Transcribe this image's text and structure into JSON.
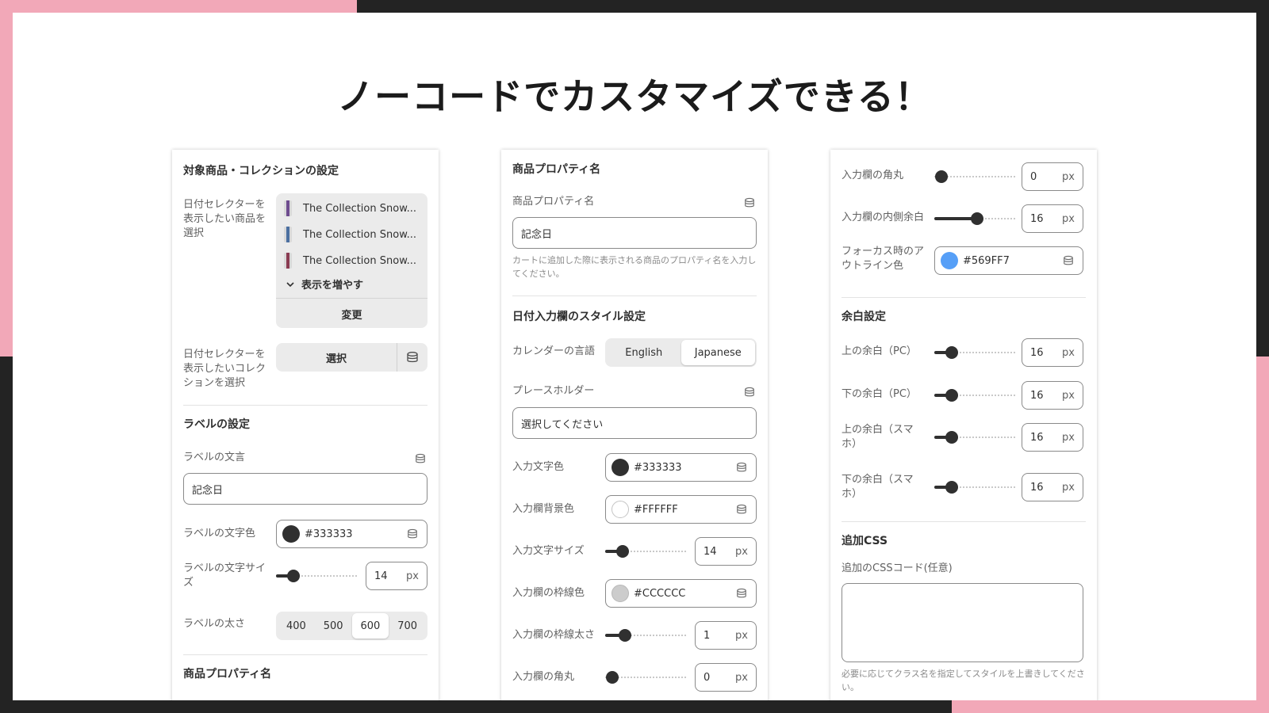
{
  "title": "ノーコードでカスタマイズできる！",
  "p1": {
    "section_target": "対象商品・コレクションの設定",
    "product_label": "日付セレクターを表示したい商品を選択",
    "products": [
      "The Collection Snow...",
      "The Collection Snow...",
      "The Collection Snow..."
    ],
    "show_more": "表示を増やす",
    "change": "変更",
    "collection_label": "日付セレクターを表示したいコレクションを選択",
    "select": "選択",
    "section_label": "ラベルの設定",
    "label_text_label": "ラベルの文言",
    "label_text_value": "記念日",
    "label_color_label": "ラベルの文字色",
    "label_color_value": "#333333",
    "label_size_label": "ラベルの文字サイズ",
    "label_size_value": "14",
    "label_weight_label": "ラベルの太さ",
    "weights": [
      "400",
      "500",
      "600",
      "700"
    ],
    "weight_selected": "600",
    "section_prop": "商品プロパティ名",
    "unit": "px"
  },
  "p2": {
    "section_prop": "商品プロパティ名",
    "prop_label": "商品プロパティ名",
    "prop_value": "記念日",
    "prop_help": "カートに追加した際に表示される商品のプロパティ名を入力してください。",
    "section_style": "日付入力欄のスタイル設定",
    "lang_label": "カレンダーの言語",
    "lang_options": [
      "English",
      "Japanese"
    ],
    "lang_selected": "Japanese",
    "placeholder_label": "プレースホルダー",
    "placeholder_value": "選択してください",
    "text_color_label": "入力文字色",
    "text_color_value": "#333333",
    "bg_color_label": "入力欄背景色",
    "bg_color_value": "#FFFFFF",
    "text_size_label": "入力文字サイズ",
    "text_size_value": "14",
    "border_color_label": "入力欄の枠線色",
    "border_color_value": "#CCCCCC",
    "border_width_label": "入力欄の枠線太さ",
    "border_width_value": "1",
    "radius_label": "入力欄の角丸",
    "radius_value": "0",
    "unit": "px"
  },
  "p3": {
    "radius_label": "入力欄の角丸",
    "radius_value": "0",
    "padding_label": "入力欄の内側余白",
    "padding_value": "16",
    "focus_label": "フォーカス時のアウトライン色",
    "focus_value": "#569FF7",
    "section_margin": "余白設定",
    "mt_pc_label": "上の余白（PC）",
    "mt_pc_value": "16",
    "mb_pc_label": "下の余白（PC）",
    "mb_pc_value": "16",
    "mt_sp_label": "上の余白（スマホ）",
    "mt_sp_value": "16",
    "mb_sp_label": "下の余白（スマホ）",
    "mb_sp_value": "16",
    "section_css": "追加CSS",
    "css_label": "追加のCSSコード(任意)",
    "css_value": "",
    "css_help": "必要に応じてクラス名を指定してスタイルを上書きしてください。",
    "unit": "px"
  },
  "colors": {
    "pink": "#f2a8b8",
    "dark": "#232323",
    "thumb": "#303030",
    "c333": "#333333",
    "cfff": "#FFFFFF",
    "cccc": "#CCCCCC",
    "focus": "#569FF7"
  },
  "icons": [
    "database-icon",
    "chevron-down-icon",
    "product-thumbnail"
  ]
}
